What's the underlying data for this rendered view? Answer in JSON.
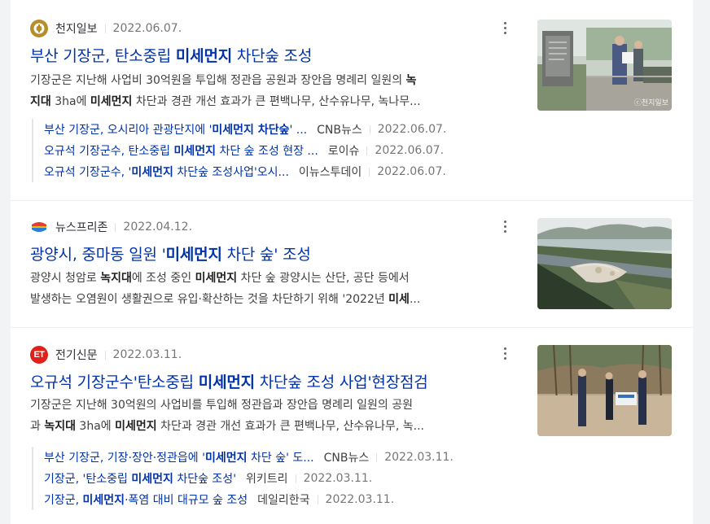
{
  "articles": [
    {
      "source": "천지일보",
      "date": "2022.06.07.",
      "title_pre": "부산 기장군, 탄소중립 ",
      "title_hl": "미세먼지",
      "title_post": " 차단숲 조성",
      "desc_l1_pre": "기장군은 지난해 사업비 30억원을 투입해 정관읍 공원과 장안읍 명례리 일원의 ",
      "desc_l1_hl": "녹",
      "desc_l2_hl1": "지대",
      "desc_l2_mid": " 3ha에 ",
      "desc_l2_hl2": "미세먼지",
      "desc_l2_post": " 차단과 경관 개선 효과가 큰 편백나무, 산수유나무, 녹나무...",
      "thumb_watermark": "ⓒ천지일보",
      "related": [
        {
          "pre": "부산 기장군, 오시리아 관광단지에 '",
          "hl": "미세먼지 차단숲",
          "post": "' ...",
          "source": "CNB뉴스",
          "date": "2022.06.07."
        },
        {
          "pre": "오규석 기장군수, 탄소중립 ",
          "hl": "미세먼지",
          "post": " 차단 숲 조성 현장 ...",
          "source": "로이슈",
          "date": "2022.06.07."
        },
        {
          "pre": "오규석 기장군수, '",
          "hl": "미세먼지",
          "post": " 차단숲 조성사업'오시...",
          "source": "이뉴스투데이",
          "date": "2022.06.07."
        }
      ]
    },
    {
      "source": "뉴스프리존",
      "date": "2022.04.12.",
      "title_pre": "광양시, 중마동 일원 '",
      "title_hl": "미세먼지",
      "title_post": " 차단 숲' 조성",
      "desc_l1_a": "광양시 청암로 ",
      "desc_l1_hl1": "녹지대",
      "desc_l1_b": "에 조성 중인 ",
      "desc_l1_hl2": "미세먼지",
      "desc_l1_c": " 차단 숲 광양시는 산단, 공단 등에서",
      "desc_l2_pre": "발생하는 오염원이 생활권으로 유입·확산하는 것을 차단하기 위해 '2022년 ",
      "desc_l2_hl": "미세",
      "desc_l2_post": "..."
    },
    {
      "source": "전기신문",
      "logo_text": "ET",
      "date": "2022.03.11.",
      "title_pre": "오규석 기장군수'탄소중립 ",
      "title_hl": "미세먼지",
      "title_post": " 차단숲 조성 사업'현장점검",
      "desc_l1": "기장군은 지난해 30억원의 사업비를 투입해 정관읍과 장안읍 명례리 일원의 공원",
      "desc_l2_a": "과 ",
      "desc_l2_hl1": "녹지대",
      "desc_l2_b": " 3ha에 ",
      "desc_l2_hl2": "미세먼지",
      "desc_l2_c": " 차단과 경관 개선 효과가 큰 편백나무, 산수유나무, 녹...",
      "related": [
        {
          "pre": "부산 기장군, 기장·장안·정관읍에 '",
          "hl": "미세먼지",
          "post": " 차단 숲' 도...",
          "source": "CNB뉴스",
          "date": "2022.03.11."
        },
        {
          "pre": "기장군, '탄소중립 ",
          "hl": "미세먼지",
          "post": " 차단숲 조성'",
          "source": "위키트리",
          "date": "2022.03.11."
        },
        {
          "pre": "기장군, ",
          "hl": "미세먼지",
          "post": "·폭염 대비 대규모 숲 조성",
          "source": "데일리한국",
          "date": "2022.03.11."
        }
      ]
    }
  ]
}
